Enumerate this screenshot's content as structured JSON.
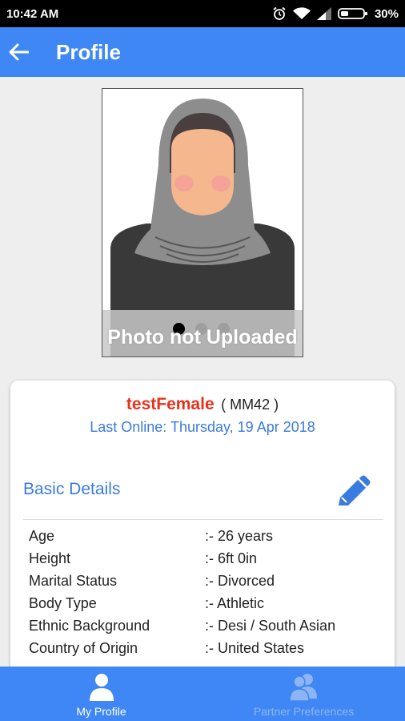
{
  "status_bar": {
    "time": "10:42 AM",
    "battery": "30%"
  },
  "app_bar": {
    "title": "Profile"
  },
  "photo": {
    "caption": "Photo not Uploaded",
    "pager_count": 3,
    "pager_active": 0
  },
  "profile": {
    "name": "testFemale",
    "id": "( MM42 )",
    "last_online": "Last Online: Thursday, 19 Apr 2018"
  },
  "basic_details": {
    "title": "Basic Details",
    "rows": [
      {
        "label": "Age",
        "value": ":- 26 years"
      },
      {
        "label": "Height",
        "value": ":- 6ft 0in"
      },
      {
        "label": "Marital Status",
        "value": ":- Divorced"
      },
      {
        "label": "Body Type",
        "value": ":- Athletic"
      },
      {
        "label": "Ethnic Background",
        "value": ":- Desi / South Asian"
      },
      {
        "label": "Country of Origin",
        "value": ":- United States"
      }
    ]
  },
  "bottom_nav": {
    "items": [
      {
        "label": "My Profile",
        "icon": "person-icon",
        "active": true
      },
      {
        "label": "Partner Preferences",
        "icon": "people-icon",
        "active": false
      }
    ]
  },
  "colors": {
    "accent": "#3f87f5",
    "name": "#e8311a",
    "link": "#3a7be0"
  }
}
